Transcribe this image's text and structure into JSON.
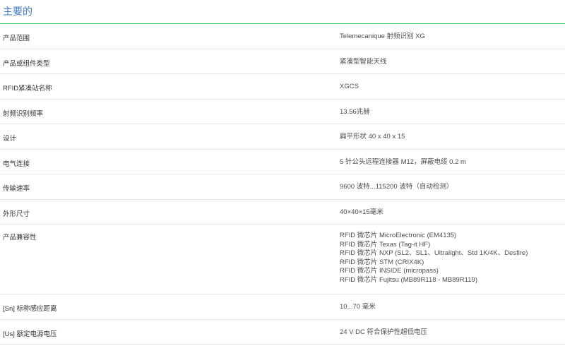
{
  "section": {
    "title": "主要的"
  },
  "specs": [
    {
      "name": "产品范围",
      "value": "Telemecanique 射频识别 XG"
    },
    {
      "name": "产品或组件类型",
      "value": "紧凑型智能天线"
    },
    {
      "name": "RFID紧凑站名称",
      "value": "XGCS"
    },
    {
      "name": "射频识别频率",
      "value": "13.56兆赫"
    },
    {
      "name": "设计",
      "value": "扁平形状 40 x 40 x 15"
    },
    {
      "name": "电气连接",
      "value": "5 针公头远程连接器 M12，屏蔽电缆 0.2 m"
    },
    {
      "name": "传输速率",
      "value": "9600 波特...115200 波特（自动检测）"
    },
    {
      "name": "外形尺寸",
      "value": "40×40×15毫米"
    },
    {
      "name": "产品兼容性",
      "values": [
        "RFID 微芯片 MicroElectronic (EM4135)",
        "RFID 微芯片 Texas (Tag-it HF)",
        "RFID 微芯片 NXP (SL2、SL1、Ultralight、Std 1K/4K、Desfire)",
        "RFID 微芯片 STM (CRIX4K)",
        "RFID 微芯片 INSIDE (micropass)",
        "RFID 微芯片 Fujitsu (MB89R118 - MB89R119)"
      ]
    },
    {
      "name": "[Sn] 标称感应距离",
      "value": "10...70 毫米"
    },
    {
      "name": "[Us] 额定电源电压",
      "value": "24 V DC 符合保护性超低电压"
    }
  ]
}
